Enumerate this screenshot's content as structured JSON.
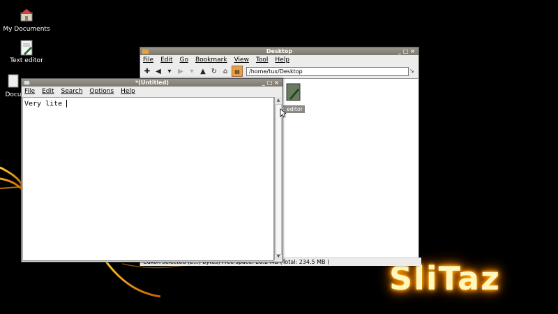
{
  "desktop": {
    "icons": [
      {
        "label": "My Documents",
        "icon": "home-folder-icon"
      },
      {
        "label": "Text editor",
        "icon": "text-editor-icon"
      },
      {
        "label": "Docu",
        "icon": "document-icon"
      }
    ],
    "brand": "SliTaz",
    "colors": {
      "background": "#000000",
      "swirl": "#f0a000",
      "brand_glow": "#ff9800"
    }
  },
  "file_manager": {
    "title": "Desktop",
    "menu": [
      "File",
      "Edit",
      "Go",
      "Bookmark",
      "View",
      "Tool",
      "Help"
    ],
    "toolbar": [
      "plus-icon",
      "back-arrow-icon",
      "chevron-down-icon",
      "forward-arrow-icon",
      "chevron-down-icon",
      "up-arrow-icon",
      "reload-icon",
      "home-icon",
      "terminal-icon"
    ],
    "address": "/home/tux/Desktop",
    "item_label": "t editor",
    "status": "Cuxon selected (E...) bytes) Free space: 20.2 MB (Total: 234.5 MB )"
  },
  "editor": {
    "title": "*(Untitled)",
    "menu": [
      "File",
      "Edit",
      "Search",
      "Options",
      "Help"
    ],
    "content": "Very lite "
  }
}
